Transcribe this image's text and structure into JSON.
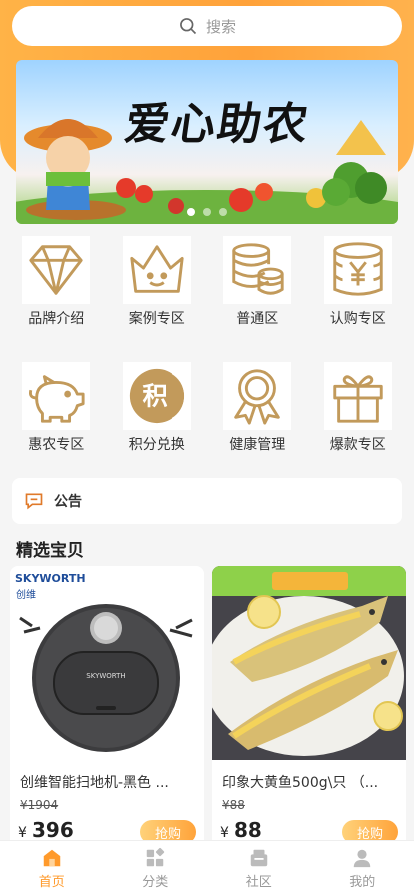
{
  "search": {
    "placeholder": "搜索"
  },
  "banner": {
    "title": "爱心助农"
  },
  "categories": [
    {
      "label": "品牌介绍",
      "icon": "diamond-icon"
    },
    {
      "label": "案例专区",
      "icon": "crown-icon"
    },
    {
      "label": "普通区",
      "icon": "coin-stack-icon"
    },
    {
      "label": "认购专区",
      "icon": "yen-coins-icon"
    },
    {
      "label": "惠农专区",
      "icon": "piggy-bank-icon"
    },
    {
      "label": "积分兑换",
      "icon": "points-icon"
    },
    {
      "label": "健康管理",
      "icon": "ribbon-award-icon"
    },
    {
      "label": "爆款专区",
      "icon": "gift-box-icon"
    }
  ],
  "points_icon_char": "积",
  "notice": {
    "label": "公告"
  },
  "section": {
    "title": "精选宝贝"
  },
  "products": [
    {
      "name": "创维智能扫地机-黑色 ...",
      "old_price": "¥1904",
      "currency": "¥",
      "price": "396",
      "button": "抢购",
      "brand": "SKYWORTH",
      "brand_cn": "创维"
    },
    {
      "name": "印象大黄鱼500g\\只 （...",
      "old_price": "¥88",
      "currency": "¥",
      "price": "88",
      "button": "抢购"
    }
  ],
  "tabs": [
    {
      "label": "首页",
      "icon": "home-icon",
      "active": true
    },
    {
      "label": "分类",
      "icon": "category-icon",
      "active": false
    },
    {
      "label": "社区",
      "icon": "community-icon",
      "active": false
    },
    {
      "label": "我的",
      "icon": "profile-icon",
      "active": false
    }
  ],
  "colors": {
    "accent": "#ffa23a",
    "icon_gold": "#c29a5b"
  }
}
